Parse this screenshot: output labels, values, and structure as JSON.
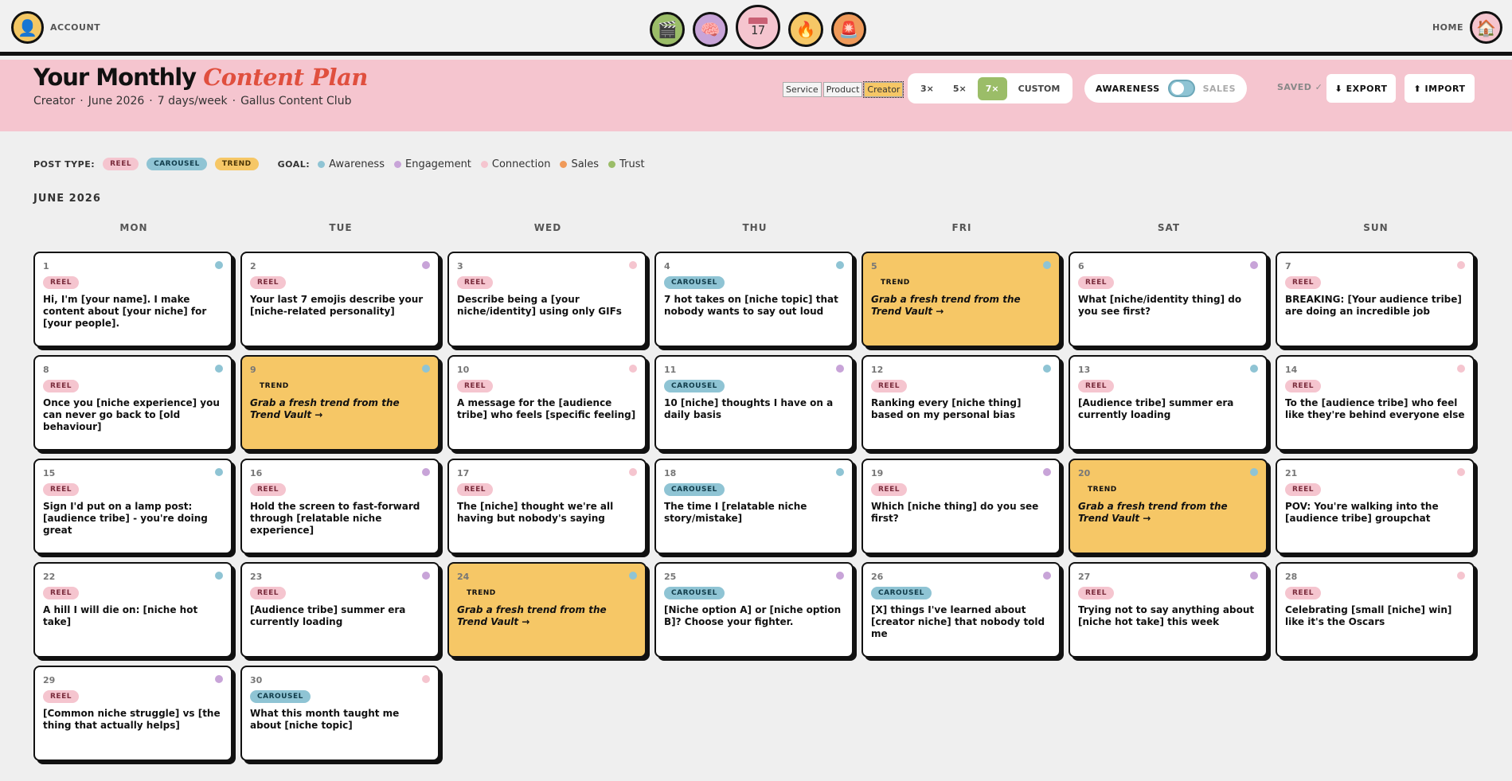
{
  "topbar": {
    "account_label": "ACCOUNT",
    "account_icon": "person-icon",
    "home_label": "HOME",
    "nav": [
      {
        "name": "clapper-icon",
        "glyph": "🎬",
        "color": "#9bbd68"
      },
      {
        "name": "brain-icon",
        "glyph": "🧠",
        "color": "#c8a4d8"
      },
      {
        "name": "calendar-icon",
        "day": "17",
        "color": "#f5c5cf"
      },
      {
        "name": "fire-icon",
        "glyph": "🔥",
        "color": "#f6c766"
      },
      {
        "name": "siren-icon",
        "glyph": "🚨",
        "color": "#f09a5a"
      }
    ]
  },
  "header": {
    "title_main": "Your Monthly",
    "title_accent": "Content Plan",
    "subtitle": [
      "Creator",
      "·",
      "June 2026",
      "·",
      "7 days/week",
      "·",
      "Gallus Content Club"
    ],
    "modes": [
      "Service",
      "Product",
      "Creator"
    ],
    "active_mode": "Creator",
    "frequency": [
      "3×",
      "5×",
      "7×",
      "CUSTOM"
    ],
    "active_frequency": "7×",
    "goal_left": "AWARENESS",
    "goal_right": "SALES",
    "saved": "SAVED ✓",
    "export": "⬇ EXPORT",
    "import": "⬆ IMPORT"
  },
  "legend": {
    "post_type_label": "POST TYPE:",
    "types": [
      {
        "label": "REEL",
        "kind": "reel"
      },
      {
        "label": "CAROUSEL",
        "kind": "carousel"
      },
      {
        "label": "TREND",
        "kind": "trend"
      }
    ],
    "goal_label": "GOAL:",
    "goals": [
      {
        "label": "Awareness",
        "color": "#8fc4d4"
      },
      {
        "label": "Engagement",
        "color": "#c8a4d8"
      },
      {
        "label": "Connection",
        "color": "#f5c5cf"
      },
      {
        "label": "Sales",
        "color": "#f09a5a"
      },
      {
        "label": "Trust",
        "color": "#9bbd68"
      }
    ]
  },
  "month_label": "JUNE 2026",
  "weekdays": [
    "MON",
    "TUE",
    "WED",
    "THU",
    "FRI",
    "SAT",
    "SUN"
  ],
  "days": [
    {
      "n": "1",
      "type": "REEL",
      "goal": "#8fc4d4",
      "text": "Hi, I'm [your name]. I make content about [your niche] for [your people]."
    },
    {
      "n": "2",
      "type": "REEL",
      "goal": "#c8a4d8",
      "text": "Your last 7 emojis describe your [niche-related personality]"
    },
    {
      "n": "3",
      "type": "REEL",
      "goal": "#f5c5cf",
      "text": "Describe being a [your niche/identity] using only GIFs"
    },
    {
      "n": "4",
      "type": "CAROUSEL",
      "goal": "#8fc4d4",
      "text": "7 hot takes on [niche topic] that nobody wants to say out loud"
    },
    {
      "n": "5",
      "type": "TREND",
      "goal": "#8fc4d4",
      "text": "Grab a fresh trend from the Trend Vault →"
    },
    {
      "n": "6",
      "type": "REEL",
      "goal": "#c8a4d8",
      "text": "What [niche/identity thing] do you see first?"
    },
    {
      "n": "7",
      "type": "REEL",
      "goal": "#f5c5cf",
      "text": "BREAKING: [Your audience tribe] are doing an incredible job"
    },
    {
      "n": "8",
      "type": "REEL",
      "goal": "#8fc4d4",
      "text": "Once you [niche experience] you can never go back to [old behaviour]"
    },
    {
      "n": "9",
      "type": "TREND",
      "goal": "#8fc4d4",
      "text": "Grab a fresh trend from the Trend Vault →"
    },
    {
      "n": "10",
      "type": "REEL",
      "goal": "#f5c5cf",
      "text": "A message for the [audience tribe] who feels [specific feeling]"
    },
    {
      "n": "11",
      "type": "CAROUSEL",
      "goal": "#c8a4d8",
      "text": "10 [niche] thoughts I have on a daily basis"
    },
    {
      "n": "12",
      "type": "REEL",
      "goal": "#8fc4d4",
      "text": "Ranking every [niche thing] based on my personal bias"
    },
    {
      "n": "13",
      "type": "REEL",
      "goal": "#8fc4d4",
      "text": "[Audience tribe] summer era currently loading"
    },
    {
      "n": "14",
      "type": "REEL",
      "goal": "#f5c5cf",
      "text": "To the [audience tribe] who feel like they're behind everyone else"
    },
    {
      "n": "15",
      "type": "REEL",
      "goal": "#8fc4d4",
      "text": "Sign I'd put on a lamp post: [audience tribe] - you're doing great"
    },
    {
      "n": "16",
      "type": "REEL",
      "goal": "#c8a4d8",
      "text": "Hold the screen to fast-forward through [relatable niche experience]"
    },
    {
      "n": "17",
      "type": "REEL",
      "goal": "#f5c5cf",
      "text": "The [niche] thought we're all having but nobody's saying"
    },
    {
      "n": "18",
      "type": "CAROUSEL",
      "goal": "#8fc4d4",
      "text": "The time I [relatable niche story/mistake]"
    },
    {
      "n": "19",
      "type": "REEL",
      "goal": "#c8a4d8",
      "text": "Which [niche thing] do you see first?"
    },
    {
      "n": "20",
      "type": "TREND",
      "goal": "#8fc4d4",
      "text": "Grab a fresh trend from the Trend Vault →"
    },
    {
      "n": "21",
      "type": "REEL",
      "goal": "#f5c5cf",
      "text": "POV: You're walking into the [audience tribe] groupchat"
    },
    {
      "n": "22",
      "type": "REEL",
      "goal": "#8fc4d4",
      "text": "A hill I will die on: [niche hot take]"
    },
    {
      "n": "23",
      "type": "REEL",
      "goal": "#c8a4d8",
      "text": "[Audience tribe] summer era currently loading"
    },
    {
      "n": "24",
      "type": "TREND",
      "goal": "#8fc4d4",
      "text": "Grab a fresh trend from the Trend Vault →"
    },
    {
      "n": "25",
      "type": "CAROUSEL",
      "goal": "#c8a4d8",
      "text": "[Niche option A] or [niche option B]? Choose your fighter."
    },
    {
      "n": "26",
      "type": "CAROUSEL",
      "goal": "#c8a4d8",
      "text": "[X] things I've learned about [creator niche] that nobody told me"
    },
    {
      "n": "27",
      "type": "REEL",
      "goal": "#c8a4d8",
      "text": "Trying not to say anything about [niche hot take] this week"
    },
    {
      "n": "28",
      "type": "REEL",
      "goal": "#f5c5cf",
      "text": "Celebrating [small [niche] win] like it's the Oscars"
    },
    {
      "n": "29",
      "type": "REEL",
      "goal": "#c8a4d8",
      "text": "[Common niche struggle] vs [the thing that actually helps]"
    },
    {
      "n": "30",
      "type": "CAROUSEL",
      "goal": "#f5c5cf",
      "text": "What this month taught me about [niche topic]"
    }
  ]
}
